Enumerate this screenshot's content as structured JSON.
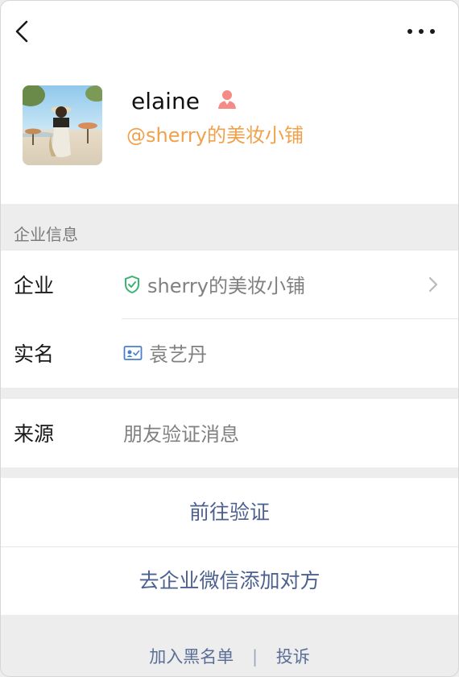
{
  "header": {
    "back_icon": "chevron-left-icon",
    "more_icon": "more-horizontal-icon"
  },
  "profile": {
    "name": "elaine",
    "corp": "@sherry的美妆小铺",
    "gender_icon": "female-icon",
    "gender_color": "#f58a86"
  },
  "section": {
    "title": "企业信息"
  },
  "info": {
    "enterprise_label": "企业",
    "enterprise_value": "sherry的美妆小铺",
    "realname_label": "实名",
    "realname_value": "袁艺丹",
    "source_label": "来源",
    "source_value": "朋友验证消息"
  },
  "actions": {
    "verify": "前往验证",
    "add": "去企业微信添加对方"
  },
  "footer": {
    "blacklist": "加入黑名单",
    "separator": "|",
    "report": "投诉"
  },
  "colors": {
    "accent_orange": "#f2a14b",
    "link_blue": "#4d6190",
    "verified_green": "#3cb371",
    "idcard_blue": "#4a7fd0"
  }
}
